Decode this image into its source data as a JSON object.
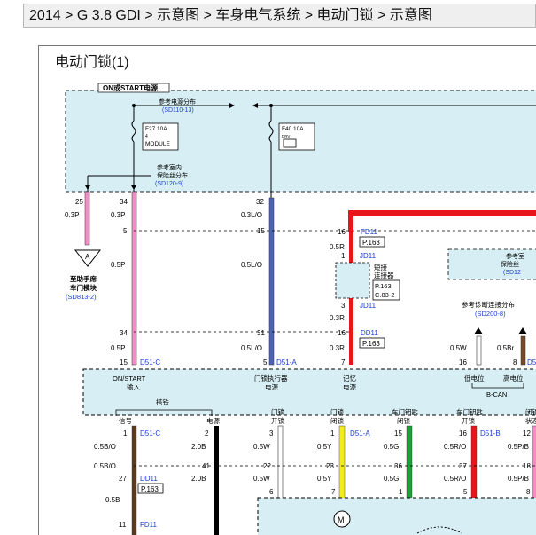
{
  "breadcrumb": {
    "text": "2014 > G 3.8 GDI > 示意图 > 车身电气系统 > 电动门锁 > 示意图"
  },
  "panel": {
    "title": "电动门锁(1)"
  },
  "diagram": {
    "top_label": "ON或START电源",
    "ref_power": "参考电源分布",
    "ref_power_code": "(SD110-13)",
    "fuse1_name": "F27 10A",
    "fuse1_num": "4",
    "fuse1_label": "MODULE",
    "fuse2_name": "F40 10A",
    "fuse2_label": "DRV",
    "ref_fuse_1": "参考室内",
    "ref_fuse_2": "保险丝分布",
    "ref_fuse_code": "(SD120-9)",
    "pin_25": "25",
    "pin_34a": "34",
    "pin_32": "32",
    "wire_03P_a": "0.3P",
    "wire_03P_b": "0.3P",
    "wire_03LO": "0.3L/O",
    "pin_5": "5",
    "pin_15": "15",
    "pin_16a": "16",
    "fd11": "FD11",
    "p163a": "P.163",
    "wire_05R": "0.5R",
    "pin_1a": "1",
    "jd11a": "JD11",
    "wire_05P_a": "0.5P",
    "wire_05LO_a": "0.5L/O",
    "tri_label": "A",
    "to_module_1": "至助手席",
    "to_module_2": "车门模块",
    "to_module_code": "(SD813-2)",
    "connector_1": "短接",
    "connector_2": "连接器",
    "connector_3": "P.163",
    "connector_4": "C.83-2",
    "ref_right_1": "参考室",
    "ref_right_2": "保险丝",
    "ref_right_code": "(SD12",
    "pin_3a": "3",
    "jd11b": "JD11",
    "ref_diag": "参考诊断连接分布",
    "ref_diag_code": "(SD200-8)",
    "wire_03R_a": "0.3R",
    "pin_34b": "34",
    "pin_31": "31",
    "pin_16b": "16",
    "dd11": "DD11",
    "wire_03R_b": "0.3R",
    "p163b": "P.163",
    "wire_05P_b": "0.5P",
    "wire_05LO_b": "0.5L/O",
    "wire_05W": "0.5W",
    "wire_05Br": "0.5Br",
    "pin_15b": "15",
    "d51c_a": "D51-C",
    "pin_5b": "5",
    "d51a_a": "D51-A",
    "pin_7a": "7",
    "pin_16c": "16",
    "pin_8a": "8",
    "d5x": "D5",
    "box_on_1": "ON/START",
    "box_on_2": "输入",
    "box_act_1": "门锁执行器",
    "box_act_2": "电源",
    "box_mem_1": "记忆",
    "box_mem_2": "电源",
    "low_level": "低电位",
    "high_level": "高电位",
    "bcan": "B-CAN",
    "col_lock": "搭铁",
    "col_signal": "信号",
    "col_power": "电源",
    "col_unlock_1": "门锁",
    "col_unlock_2": "开锁",
    "col_lockc_1": "门锁",
    "col_lockc_2": "闭锁",
    "col_key_1": "车门钥匙",
    "col_key_2": "闭锁",
    "col_keyo_1": "车门钥匙",
    "col_keyo_2": "开锁",
    "col_last_1": "闭锁",
    "col_last_2": "状态",
    "pin_1b": "1",
    "d51c_b": "D51-C",
    "pin_2": "2",
    "pin_3b": "3",
    "pin_1c": "1",
    "d51a_b": "D51-A",
    "pin_15c": "15",
    "pin_16d": "16",
    "d51b": "D51-B",
    "pin_12": "12",
    "wire_05BO_a": "0.5B/O",
    "wire_20B_a": "2.0B",
    "wire_05W_b": "0.5W",
    "wire_05Y_a": "0.5Y",
    "wire_05G_a": "0.5G",
    "wire_05RO_a": "0.5R/O",
    "wire_05PB_a": "0.5P/B",
    "wire_05BO_b": "0.5B/O",
    "pin_41": "41",
    "pin_22": "22",
    "pin_23": "23",
    "pin_36": "36",
    "pin_37": "37",
    "pin_18": "18",
    "pin_27": "27",
    "dd11b": "DD11",
    "p163c": "P.163",
    "wire_20B_b": "2.0B",
    "wire_05W_c": "0.5W",
    "wire_05Y_b": "0.5Y",
    "wire_05G_b": "0.5G",
    "wire_05RO_b": "0.5R/O",
    "wire_05PB_b": "0.5P/B",
    "wire_05B": "0.5B",
    "pin_6": "6",
    "pin_7b": "7",
    "pin_1d": "1",
    "pin_5c": "5",
    "pin_8b": "8",
    "pin_11": "11",
    "fd11b": "FD11",
    "motor": "M"
  }
}
